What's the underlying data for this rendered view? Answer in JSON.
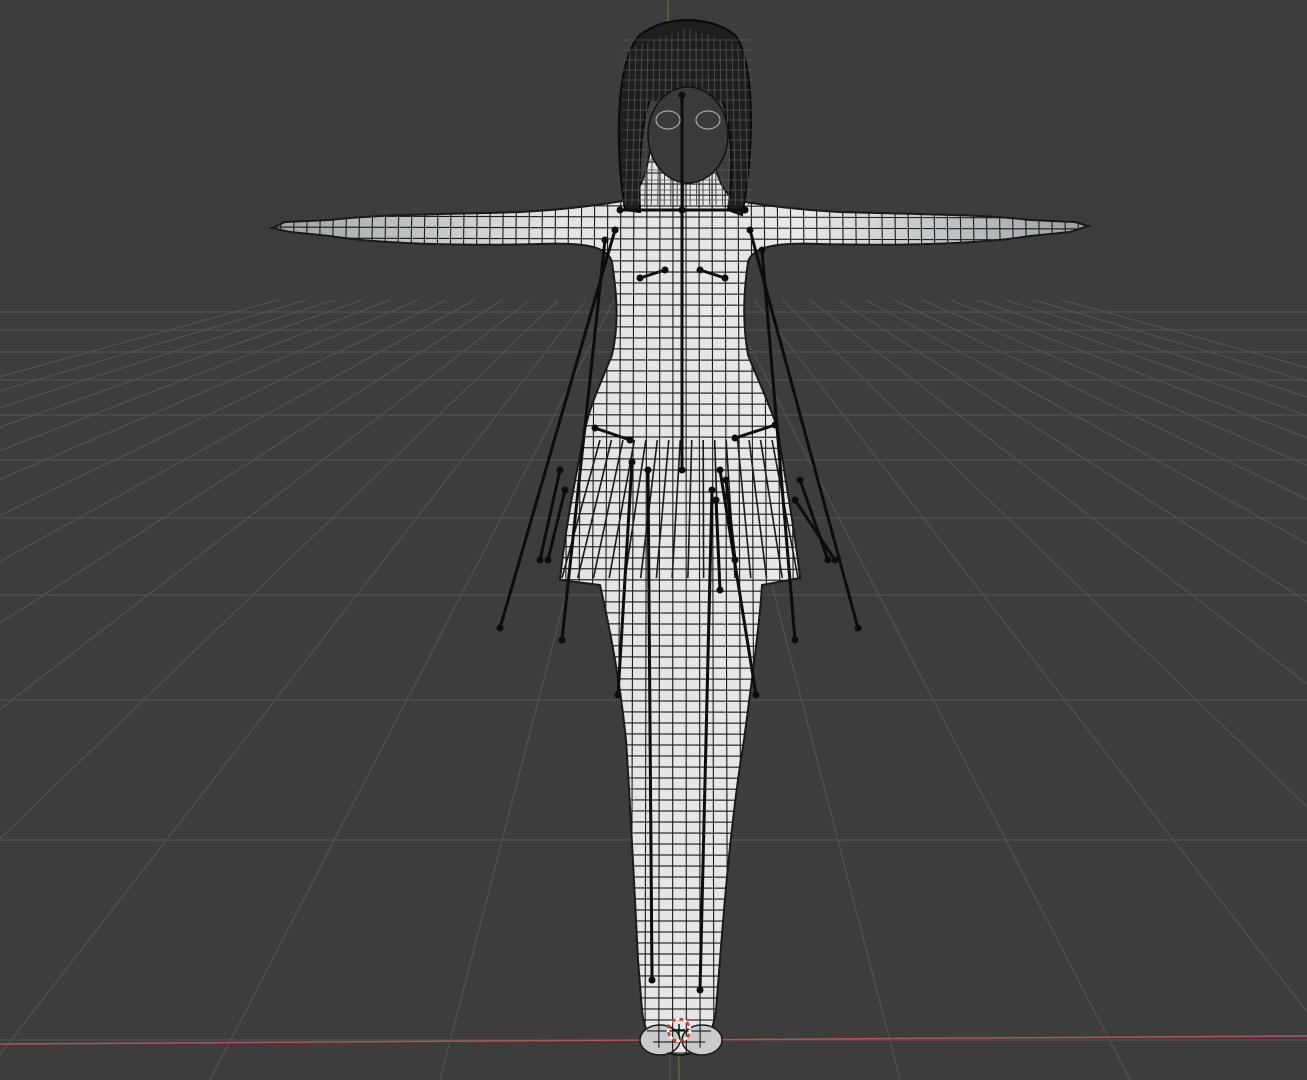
{
  "viewport": {
    "background": "#3d3d3d",
    "grid_color": "#555555",
    "x_axis_color": "#b5505a",
    "y_axis_color": "#7fa630",
    "mesh_fill": "#dcdedf",
    "wire_color": "#1a1a1a",
    "bone_color": "#0c0c0c",
    "origin_marker_colors": [
      "#e23b2f",
      "#ffffff"
    ]
  },
  "scene": {
    "object": "character-mesh-with-armature",
    "pose": "t-pose",
    "view": "front-perspective"
  }
}
